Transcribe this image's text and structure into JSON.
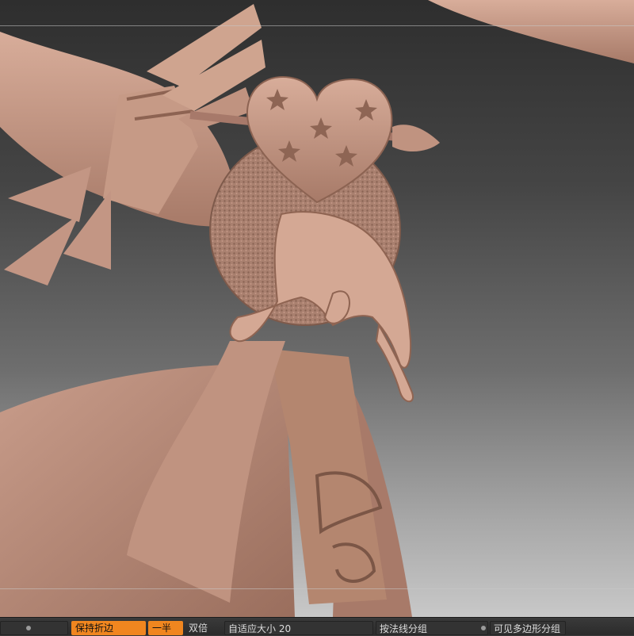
{
  "toolbar": {
    "keep_crease_label": "保持折边",
    "half_label": "一半",
    "double_label": "双倍",
    "adaptive_size_label": "自适应大小",
    "adaptive_size_value": "20",
    "group_by_normals_label": "按法线分组",
    "group_visible_polys_label": "可见多边形分组"
  },
  "colors": {
    "accent": "#f0861f",
    "clay": "#b88a78",
    "toolbar_bg": "#2f2f2f"
  }
}
